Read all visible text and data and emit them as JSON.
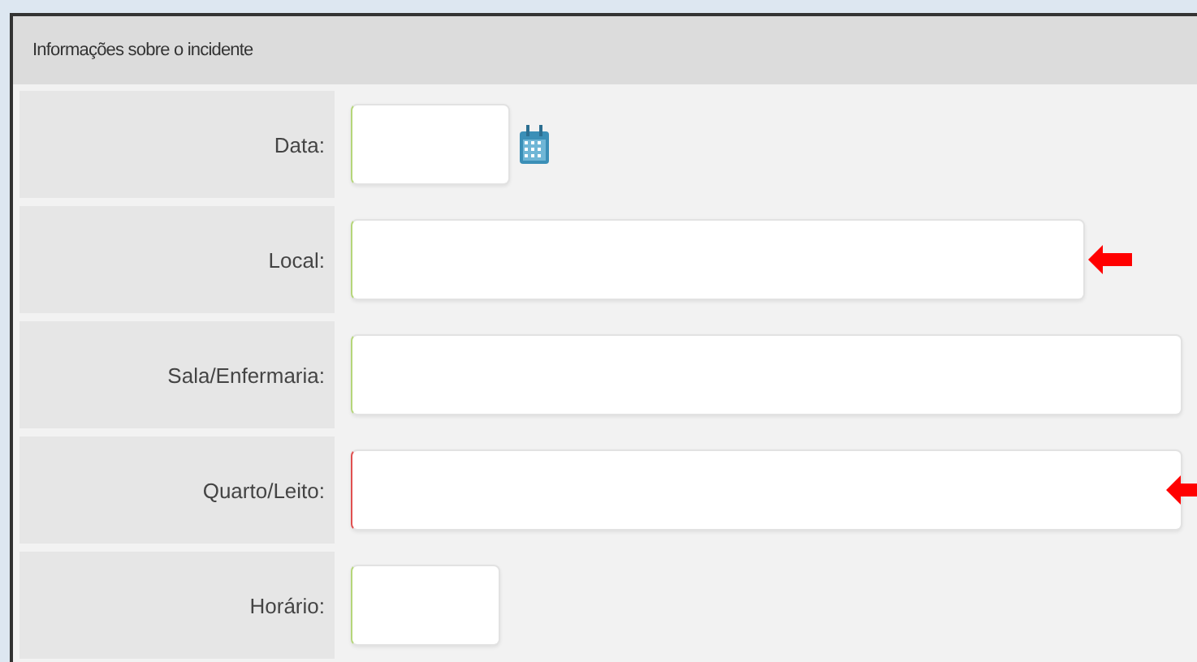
{
  "panel": {
    "title": "Informações sobre o incidente"
  },
  "fields": [
    {
      "label": "Data:",
      "kind": "date",
      "invalid": false,
      "marked": false
    },
    {
      "label": "Local:",
      "kind": "medium",
      "invalid": false,
      "marked": true
    },
    {
      "label": "Sala/Enfermaria:",
      "kind": "long",
      "invalid": false,
      "marked": false
    },
    {
      "label": "Quarto/Leito:",
      "kind": "long",
      "invalid": true,
      "marked": true
    },
    {
      "label": "Horário:",
      "kind": "short",
      "invalid": false,
      "marked": false
    }
  ]
}
